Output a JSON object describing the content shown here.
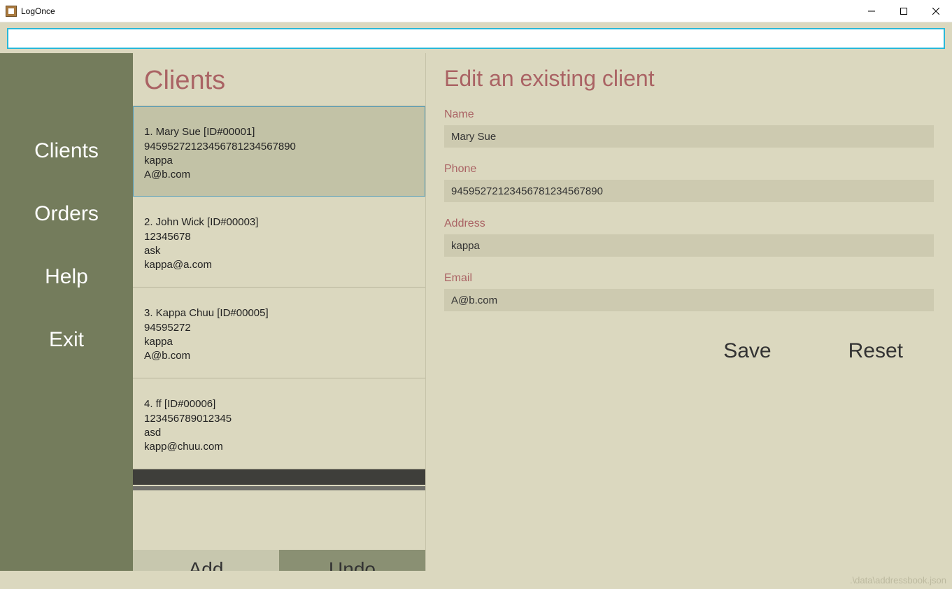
{
  "window": {
    "title": "LogOnce"
  },
  "searchbar": {
    "value": "",
    "placeholder": ""
  },
  "sidebar": {
    "items": [
      {
        "label": "Clients"
      },
      {
        "label": "Orders"
      },
      {
        "label": "Help"
      },
      {
        "label": "Exit"
      }
    ]
  },
  "list": {
    "title": "Clients",
    "add_label": "Add",
    "undo_label": "Undo",
    "clients": [
      {
        "index": "1.",
        "name": "Mary Sue",
        "id": "[ID#00001]",
        "phone": "9459527212345678123456789‌0",
        "address": "kappa",
        "email": "A@b.com",
        "selected": true
      },
      {
        "index": "2.",
        "name": "John Wick",
        "id": "[ID#00003]",
        "phone": "12345678",
        "address": "ask",
        "email": "kappa@a.com",
        "selected": false
      },
      {
        "index": "3.",
        "name": "Kappa Chuu",
        "id": "[ID#00005]",
        "phone": "94595272",
        "address": "kappa",
        "email": "A@b.com",
        "selected": false
      },
      {
        "index": "4.",
        "name": "ff",
        "id": "[ID#00006]",
        "phone": "123456789012345",
        "address": "asd",
        "email": "kapp@chuu.com",
        "selected": false
      }
    ]
  },
  "detail": {
    "title": "Edit an existing client",
    "name_label": "Name",
    "name_value": "Mary Sue",
    "phone_label": "Phone",
    "phone_value": "9459527212345678123456789‌0",
    "address_label": "Address",
    "address_value": "kappa",
    "email_label": "Email",
    "email_value": "A@b.com",
    "save_label": "Save",
    "reset_label": "Reset"
  },
  "statusbar": {
    "path": ".\\data\\addressbook.json"
  }
}
